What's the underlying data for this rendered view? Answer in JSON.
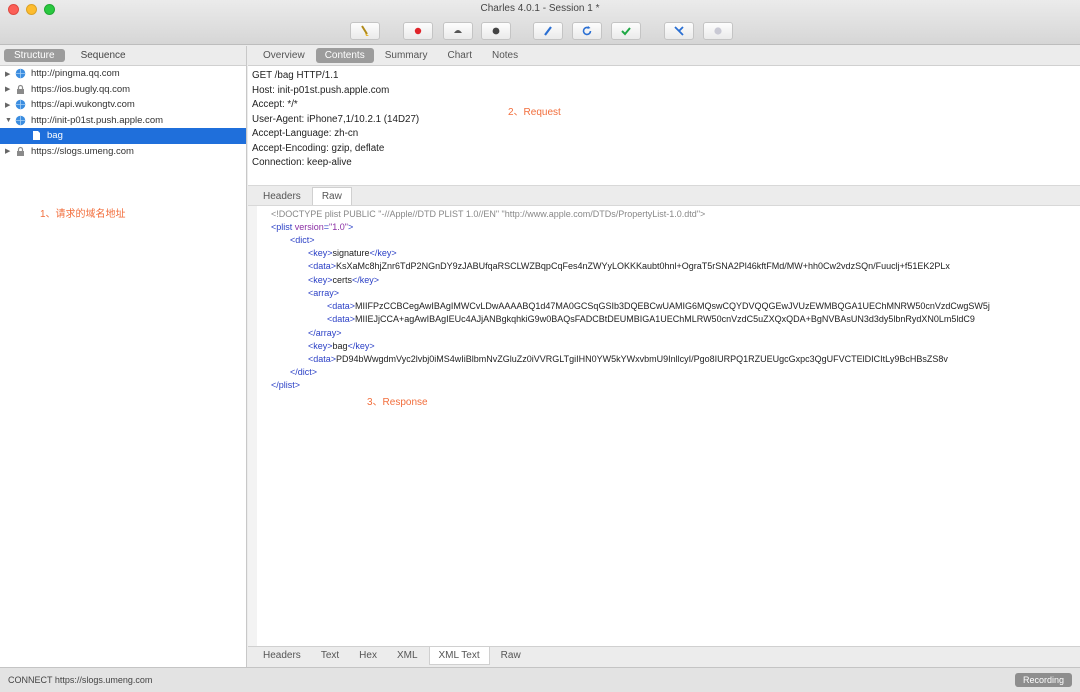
{
  "window": {
    "title": "Charles 4.0.1 - Session 1 *"
  },
  "toolbar": {
    "buttons": [
      {
        "name": "broom-icon"
      },
      {
        "name": "record-icon"
      },
      {
        "name": "turtle-icon"
      },
      {
        "name": "breakpoint-icon"
      },
      {
        "name": "pen-icon"
      },
      {
        "name": "refresh-icon"
      },
      {
        "name": "check-icon"
      },
      {
        "name": "tools-icon"
      },
      {
        "name": "settings-icon"
      }
    ]
  },
  "left": {
    "tabs": [
      "Structure",
      "Sequence"
    ],
    "active_tab": "Structure",
    "tree": [
      {
        "label": "http://pingma.qq.com",
        "icon": "globe-icon",
        "level": 0,
        "expanded": false
      },
      {
        "label": "https://ios.bugly.qq.com",
        "icon": "lock-icon",
        "level": 0,
        "expanded": false
      },
      {
        "label": "https://api.wukongtv.com",
        "icon": "globe-icon",
        "level": 0,
        "expanded": false
      },
      {
        "label": "http://init-p01st.push.apple.com",
        "icon": "globe-icon",
        "level": 0,
        "expanded": true
      },
      {
        "label": "bag",
        "icon": "file-icon",
        "level": 1,
        "selected": true
      },
      {
        "label": "https://slogs.umeng.com",
        "icon": "lock-icon",
        "level": 0,
        "expanded": false
      }
    ],
    "annotation": "1、请求的域名地址"
  },
  "right": {
    "top_tabs": [
      "Overview",
      "Contents",
      "Summary",
      "Chart",
      "Notes"
    ],
    "active_top_tab": "Contents",
    "request_lines": [
      "GET /bag HTTP/1.1",
      "Host: init-p01st.push.apple.com",
      "Accept: */*",
      "User-Agent: iPhone7,1/10.2.1 (14D27)",
      "Accept-Language: zh-cn",
      "Accept-Encoding: gzip, deflate",
      "Connection: keep-alive"
    ],
    "request_annotation": "2、Request",
    "response_tabs": [
      "Headers",
      "Raw"
    ],
    "active_response_tab": "Raw",
    "xml": {
      "doctype": "<!DOCTYPE plist PUBLIC \"-//Apple//DTD PLIST 1.0//EN\" \"http://www.apple.com/DTDs/PropertyList-1.0.dtd\">",
      "plist_attr": "version",
      "plist_attr_value": "\"1.0\"",
      "signature_key": "signature",
      "signature_data": "KsXaMc8hjZnr6TdP2NGnDY9zJABUfqaRSCLWZBqpCqFes4nZWYyLOKKKaubt0hnl+OgraT5rSNA2Pl46kftFMd/MW+hh0Cw2vdzSQn/Fuuclj+f51EK2PLx",
      "certs_key": "certs",
      "cert1": "MIIFPzCCBCegAwIBAgIMWCvLDwAAAABQ1d47MA0GCSqGSIb3DQEBCwUAMIG6MQswCQYDVQQGEwJVUzEWMBQGA1UEChMNRW50cnVzdCwgSW5j",
      "cert2": "MIIEJjCCA+agAwIBAgIEUc4AJjANBgkqhkiG9w0BAQsFADCBtDEUMBIGA1UEChMLRW50cnVzdC5uZXQxQDA+BgNVBAsUN3d3dy5lbnRydXN0Lm5ldC9",
      "bag_key": "bag",
      "bag_data": "PD94bWwgdmVyc2lvbj0iMS4wIiBlbmNvZGluZz0iVVRGLTgiIHN0YW5kYWxvbmU9InllcyI/Pgo8IURPQ1RZUEUgcGxpc3QgUFVCTElDICItLy9BcHBsZS8v"
    },
    "response_annotation": "3、Response",
    "bottom_tabs": [
      "Headers",
      "Text",
      "Hex",
      "XML",
      "XML Text",
      "Raw"
    ],
    "active_bottom_tab": "XML Text"
  },
  "status": {
    "text": "CONNECT https://slogs.umeng.com",
    "recording": "Recording"
  }
}
